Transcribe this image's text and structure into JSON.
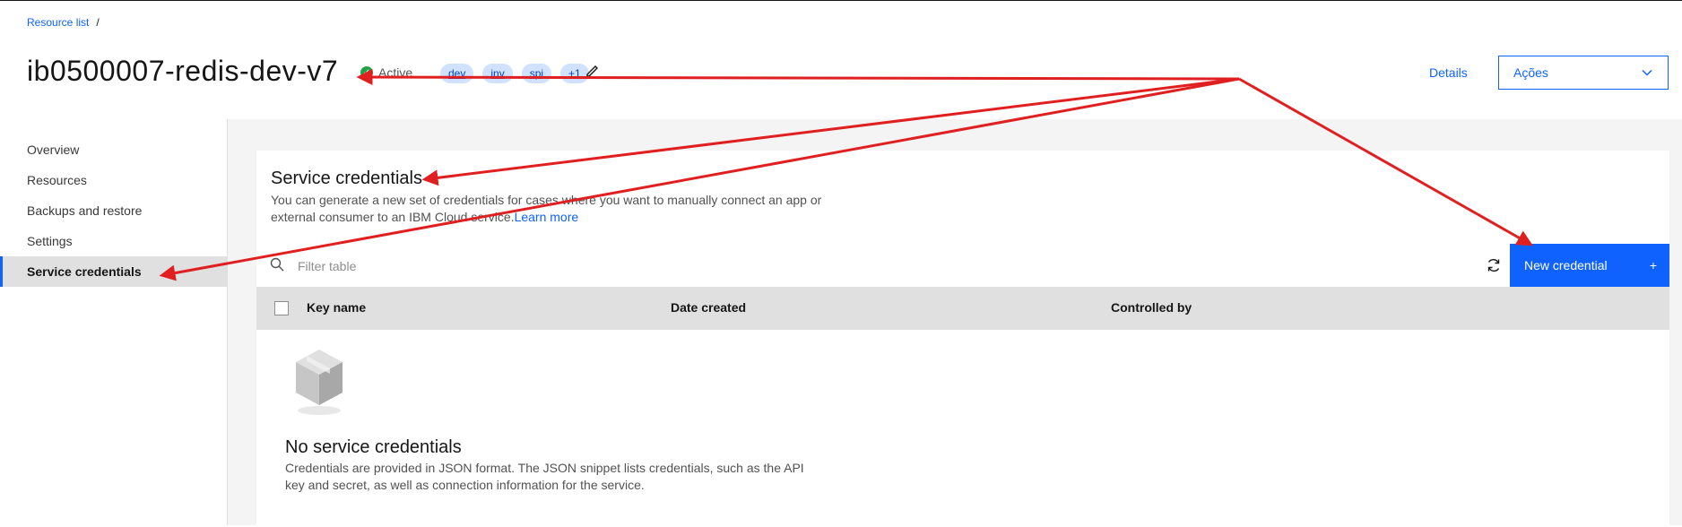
{
  "breadcrumb": {
    "link": "Resource list",
    "separator": "/"
  },
  "header": {
    "title": "ib0500007-redis-dev-v7",
    "status": "Active",
    "tags": [
      "dev",
      "inv",
      "spi",
      "+1"
    ],
    "details_label": "Details",
    "actions_label": "Ações"
  },
  "sidebar": {
    "items": [
      {
        "label": "Overview"
      },
      {
        "label": "Resources"
      },
      {
        "label": "Backups and restore"
      },
      {
        "label": "Settings"
      },
      {
        "label": "Service credentials"
      }
    ]
  },
  "card": {
    "title": "Service credentials",
    "description_text": "You can generate a new set of credentials for cases where you want to manually connect an app or external consumer to an IBM Cloud service.",
    "learn_more": "Learn more"
  },
  "toolbar": {
    "search_placeholder": "Filter table",
    "new_credential_label": "New credential",
    "new_credential_icon": "+"
  },
  "table": {
    "columns": [
      "Key name",
      "Date created",
      "Controlled by"
    ]
  },
  "empty_state": {
    "title": "No service credentials",
    "description": "Credentials are provided in JSON format. The JSON snippet lists credentials, such as the API key and secret, as well as connection information for the service."
  },
  "colors": {
    "accent": "#0f62fe",
    "status_active": "#24a148",
    "annotation_arrow": "#e02020"
  }
}
